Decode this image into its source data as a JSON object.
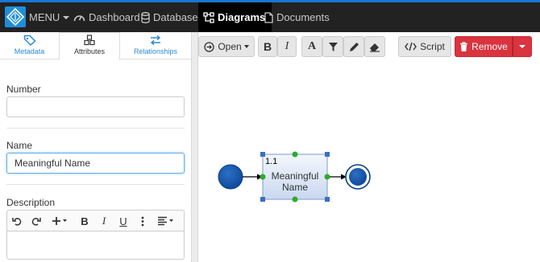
{
  "nav": {
    "menu": "MENU",
    "dashboard": "Dashboard",
    "database": "Database",
    "diagrams": "Diagrams",
    "documents": "Documents"
  },
  "tabs": {
    "metadata": "Metadata",
    "attributes": "Attributes",
    "relationships": "Relationships",
    "active": "Attributes"
  },
  "form": {
    "number_label": "Number",
    "number_value": "",
    "name_label": "Name",
    "name_value": "Meaningful Name",
    "description_label": "Description",
    "description_value": ""
  },
  "editor_icons": [
    "undo-icon",
    "redo-icon",
    "plus-icon",
    "bold-icon",
    "italic-icon",
    "underline-icon",
    "more-icon",
    "align-icon"
  ],
  "toolbar": {
    "open": "Open",
    "bold": "B",
    "italic": "I",
    "font": "A",
    "script": "Script",
    "remove": "Remove"
  },
  "diagram": {
    "task_id": "1.1",
    "task_label_line1": "Meaningful",
    "task_label_line2": "Name"
  },
  "colors": {
    "accent": "#1976d2",
    "nav_bg": "#222222",
    "remove_button": "#d9343f",
    "event_fill": "#0d4a9b",
    "task_fill": "#dce6f5"
  }
}
